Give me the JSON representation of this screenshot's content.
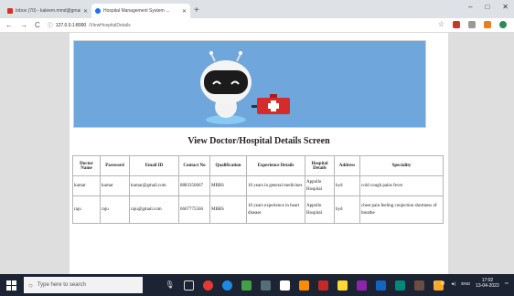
{
  "browser": {
    "tabs": [
      {
        "label": "Inbox (70) - kaleem.mmd@gmail...",
        "active": false,
        "favicon_color": "#d93025"
      },
      {
        "label": "Hospital Management System ...",
        "active": true,
        "favicon_color": "#1a73e8"
      }
    ],
    "new_tab": "+",
    "window_controls": [
      "–",
      "□",
      "✕"
    ],
    "url": {
      "prefix": "127.0.0.1:8000",
      "path": "/ViewHospitalDetails"
    }
  },
  "page": {
    "screen_title": "View Doctor/Hospital Details Screen",
    "table": {
      "headers": [
        "Doctor Name",
        "Password",
        "Email ID",
        "Contact No",
        "Qualification",
        "Experience Details",
        "Hospital Details",
        "Address",
        "Speciality"
      ],
      "rows": [
        [
          "kumar",
          "kumar",
          "kumar@gmail.com",
          "8883356667",
          "MBBS",
          "10 years in general medicines",
          "Appollo Hospital",
          "hyd",
          "cold cough pains fever"
        ],
        [
          "raju",
          "raju",
          "raju@gmail.com",
          "6667775566",
          "MBBS",
          "10 years experience in heart disease",
          "Appollo Hospital",
          "hyd",
          "chest pain feeling conjection shortness of breathe"
        ]
      ]
    }
  },
  "taskbar": {
    "search_placeholder": "Type here to search",
    "time": "17:02",
    "date": "13-04-2022",
    "lang": "ENG"
  },
  "colors": {
    "banner_bg": "#6fa6dc",
    "taskbar_bg": "#1c2433",
    "page_bg": "#dedede"
  }
}
